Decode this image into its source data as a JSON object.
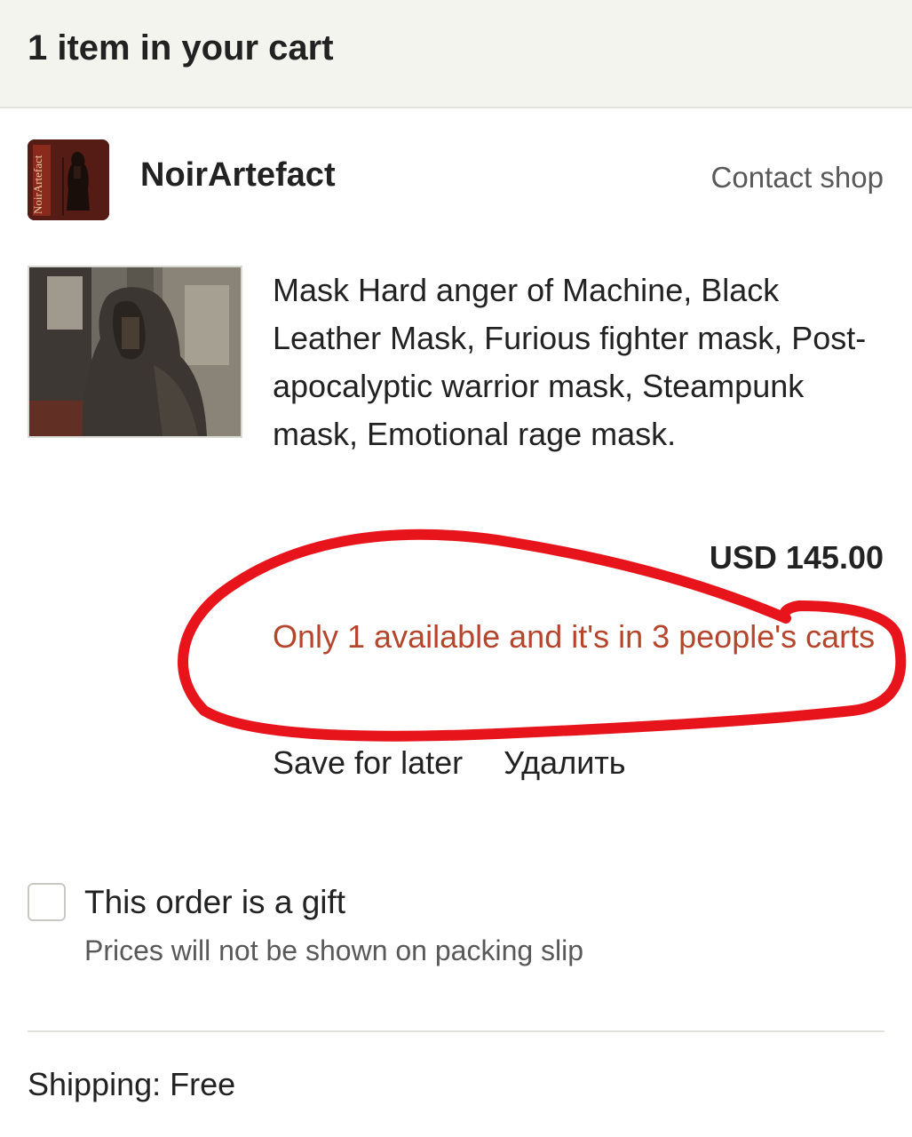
{
  "header": {
    "title": "1 item in your cart"
  },
  "shop": {
    "name": "NoirArtefact",
    "contact_label": "Contact shop",
    "avatar_text": "NoirArtefact"
  },
  "item": {
    "title": "Mask Hard anger of Machine, Black Leather Mask, Furious fighter mask, Post-apocalyptic warrior mask, Steampunk mask, Emotional rage mask.",
    "price": "USD 145.00",
    "availability": "Only 1 available and it's in 3 people's carts",
    "save_for_later_label": "Save for later",
    "remove_label": "Удалить"
  },
  "gift": {
    "label": "This order is a gift",
    "help": "Prices will not be shown on packing slip",
    "checked": false
  },
  "shipping": {
    "text": "Shipping: Free"
  },
  "colors": {
    "header_bg": "#f4f4ef",
    "availability_text": "#b5462d",
    "annotation_red": "#e8141c",
    "muted_text": "#595959"
  },
  "icons": {
    "avatar": "shop-logo-icon",
    "product": "product-thumbnail"
  }
}
